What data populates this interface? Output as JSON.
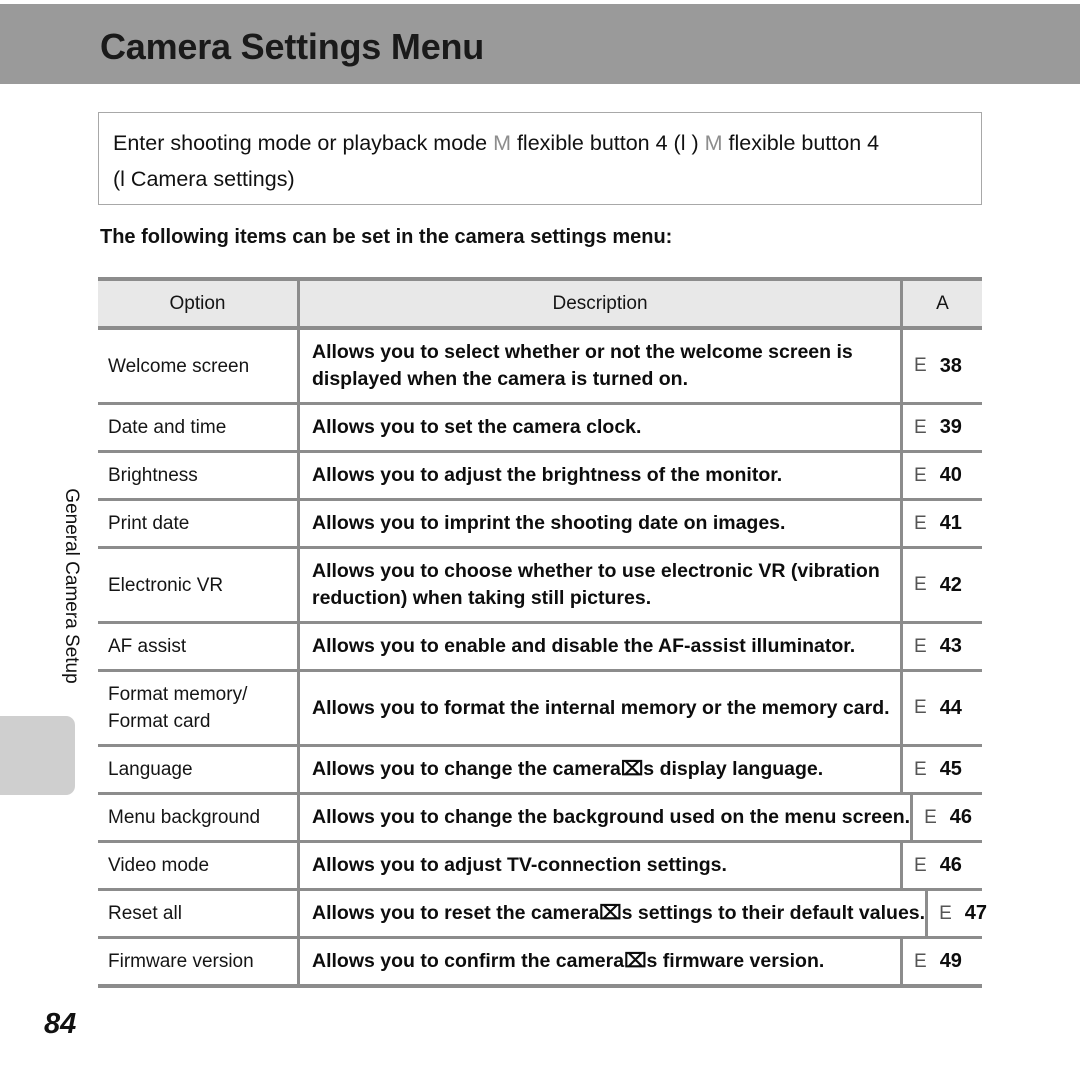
{
  "header": {
    "title": "Camera Settings Menu",
    "bar_color": "#9a9a9a"
  },
  "side_tab": {
    "label": "General Camera Setup",
    "marker_color": "#cfcfcf"
  },
  "instruction": {
    "line1_part1": "Enter shooting mode or playback mode ",
    "arrow_symbol_1": "M",
    "line1_part2": " flexible button 4 (",
    "icon_symbol_1": "l",
    "line1_part3": " ) ",
    "arrow_symbol_2": "M",
    "line1_part4": " flexible button 4",
    "line2_part1": "(",
    "icon_symbol_2": "l",
    "line2_part2": "  Camera settings)"
  },
  "subtitle": "The following items can be set in the camera settings menu:",
  "table": {
    "headers": {
      "option": "Option",
      "description": "Description",
      "reference": "A"
    },
    "rows": [
      {
        "option": "Welcome screen",
        "description": "Allows you to select whether or not the welcome screen is displayed when the camera is turned on.",
        "ref_symbol": "E",
        "page": "38",
        "wrap": true
      },
      {
        "option": "Date and time",
        "description": "Allows you to set the camera clock.",
        "ref_symbol": "E",
        "page": "39",
        "wrap": false
      },
      {
        "option": "Brightness",
        "description": "Allows you to adjust the brightness of the monitor.",
        "ref_symbol": "E",
        "page": "40",
        "wrap": false
      },
      {
        "option": "Print date",
        "description": "Allows you to imprint the shooting date on images.",
        "ref_symbol": "E",
        "page": "41",
        "wrap": false
      },
      {
        "option": "Electronic VR",
        "description": "Allows you to choose whether to use electronic VR (vibration reduction) when taking still pictures.",
        "ref_symbol": "E",
        "page": "42",
        "wrap": true
      },
      {
        "option": "AF assist",
        "description": "Allows you to enable and disable the AF-assist illuminator.",
        "ref_symbol": "E",
        "page": "43",
        "wrap": false
      },
      {
        "option": "Format memory/ Format card",
        "description": "Allows you to format the internal memory or the memory card.",
        "ref_symbol": "E",
        "page": "44",
        "wrap": false
      },
      {
        "option": "Language",
        "description": "Allows you to change the camera⌧s display language.",
        "ref_symbol": "E",
        "page": "45",
        "wrap": false
      },
      {
        "option": "Menu background",
        "description": "Allows you to change the background used on the menu screen.",
        "ref_symbol": "E",
        "page": "46",
        "wrap": false
      },
      {
        "option": "Video mode",
        "description": "Allows you to adjust TV-connection settings.",
        "ref_symbol": "E",
        "page": "46",
        "wrap": false
      },
      {
        "option": "Reset all",
        "description": "Allows you to reset the camera⌧s settings to their default values.",
        "ref_symbol": "E",
        "page": "47",
        "wrap": false
      },
      {
        "option": "Firmware version",
        "description": "Allows you to confirm the camera⌧s firmware version.",
        "ref_symbol": "E",
        "page": "49",
        "wrap": false
      }
    ]
  },
  "page_number": "84"
}
